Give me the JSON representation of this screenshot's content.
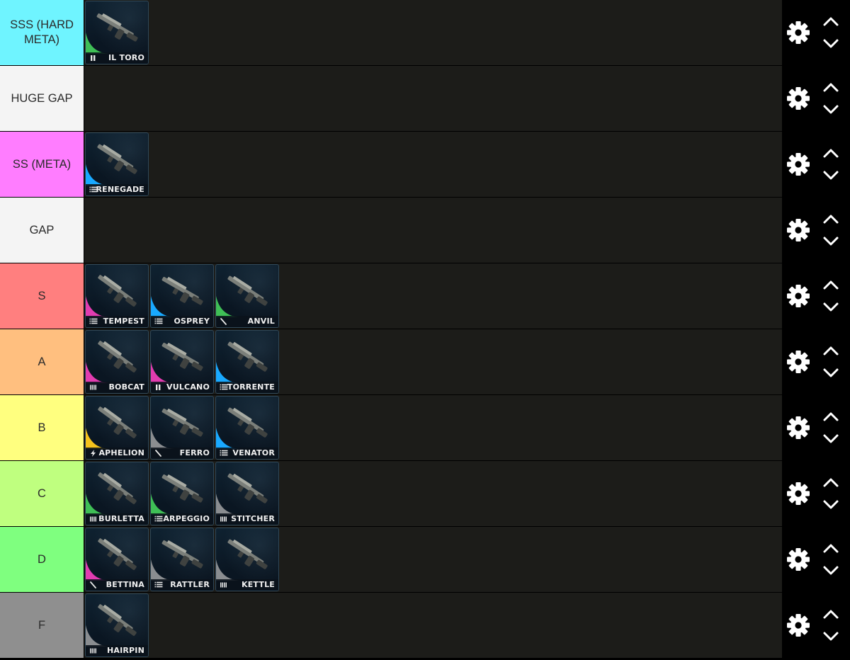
{
  "tiers": [
    {
      "label": "SSS (HARD META)",
      "color": "#6ff4ff",
      "items": [
        {
          "name": "IL TORO",
          "rarity": "#3fbf56",
          "ammo": "shells-icon"
        }
      ]
    },
    {
      "label": "HUGE GAP",
      "color": "#f4f4f4",
      "items": []
    },
    {
      "label": "SS (META)",
      "color": "#ff7dff",
      "items": [
        {
          "name": "RENEGADE",
          "rarity": "#19a9ff",
          "ammo": "rifle-ammo-icon"
        }
      ]
    },
    {
      "label": "GAP",
      "color": "#f4f4f4",
      "items": []
    },
    {
      "label": "S",
      "color": "#ff7f7f",
      "items": [
        {
          "name": "TEMPEST",
          "rarity": "#e23cb0",
          "ammo": "rifle-ammo-icon"
        },
        {
          "name": "OSPREY",
          "rarity": "#19a9ff",
          "ammo": "rifle-ammo-icon"
        },
        {
          "name": "ANVIL",
          "rarity": "#3fbf56",
          "ammo": "heavy-ammo-icon"
        }
      ]
    },
    {
      "label": "A",
      "color": "#ffbf7f",
      "items": [
        {
          "name": "BOBCAT",
          "rarity": "#e23cb0",
          "ammo": "light-ammo-icon"
        },
        {
          "name": "VULCANO",
          "rarity": "#e23cb0",
          "ammo": "shells-icon"
        },
        {
          "name": "TORRENTE",
          "rarity": "#19a9ff",
          "ammo": "rifle-ammo-icon"
        }
      ]
    },
    {
      "label": "B",
      "color": "#ffff7f",
      "items": [
        {
          "name": "APHELION",
          "rarity": "#f5c21c",
          "ammo": "energy-ammo-icon"
        },
        {
          "name": "FERRO",
          "rarity": "#8a8d90",
          "ammo": "heavy-ammo-icon"
        },
        {
          "name": "VENATOR",
          "rarity": "#19a9ff",
          "ammo": "rifle-ammo-icon"
        }
      ]
    },
    {
      "label": "C",
      "color": "#bfff7f",
      "items": [
        {
          "name": "BURLETTA",
          "rarity": "#3fbf56",
          "ammo": "light-ammo-icon"
        },
        {
          "name": "ARPEGGIO",
          "rarity": "#3fbf56",
          "ammo": "rifle-ammo-icon"
        },
        {
          "name": "STITCHER",
          "rarity": "#8a8d90",
          "ammo": "light-ammo-icon"
        }
      ]
    },
    {
      "label": "D",
      "color": "#7fff7f",
      "items": [
        {
          "name": "BETTINA",
          "rarity": "#e23cb0",
          "ammo": "heavy-ammo-icon"
        },
        {
          "name": "RATTLER",
          "rarity": "#8a8d90",
          "ammo": "rifle-ammo-icon"
        },
        {
          "name": "KETTLE",
          "rarity": "#8a8d90",
          "ammo": "light-ammo-icon"
        }
      ]
    },
    {
      "label": "F",
      "color": "#8f8f8f",
      "items": [
        {
          "name": "HAIRPIN",
          "rarity": "#8a8d90",
          "ammo": "light-ammo-icon"
        }
      ]
    }
  ],
  "controls": {
    "settings": "gear-icon",
    "up": "chevron-up-icon",
    "down": "chevron-down-icon"
  }
}
